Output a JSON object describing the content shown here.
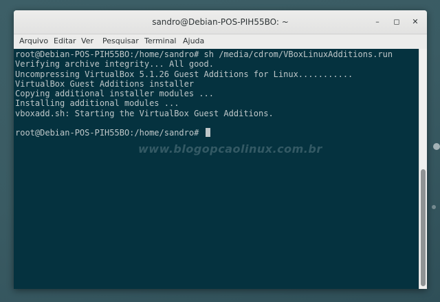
{
  "window": {
    "title": "sandro@Debian-POS-PIH55BO: ~",
    "minimize_glyph": "–",
    "maximize_glyph": "◻",
    "close_glyph": "✕"
  },
  "menu": [
    "Arquivo",
    "Editar",
    "Ver",
    "Pesquisar",
    "Terminal",
    "Ajuda"
  ],
  "terminal": {
    "lines": [
      "root@Debian-POS-PIH55BO:/home/sandro# sh /media/cdrom/VBoxLinuxAdditions.run",
      "Verifying archive integrity... All good.",
      "Uncompressing VirtualBox 5.1.26 Guest Additions for Linux...........",
      "VirtualBox Guest Additions installer",
      "Copying additional installer modules ...",
      "Installing additional modules ...",
      "vboxadd.sh: Starting the VirtualBox Guest Additions.",
      "",
      "root@Debian-POS-PIH55BO:/home/sandro# "
    ],
    "background": "#05323f",
    "foreground": "#bfc7c9"
  },
  "watermark": "www.blogopcaolinux.com.br"
}
